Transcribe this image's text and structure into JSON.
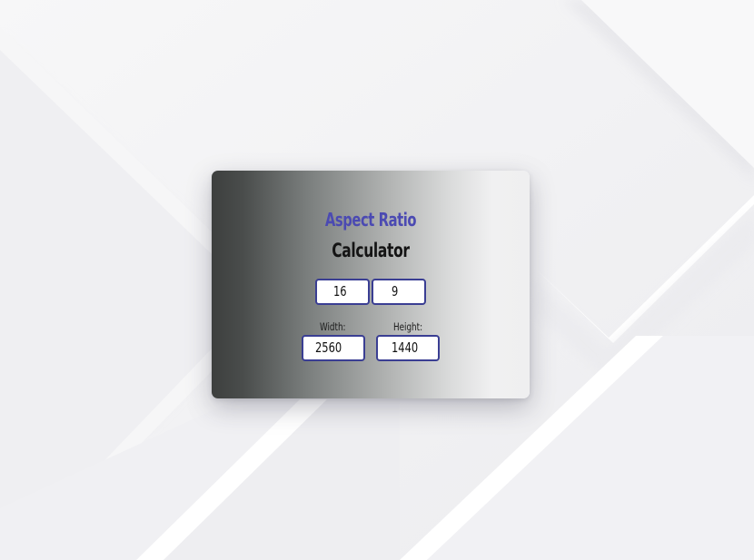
{
  "title": {
    "line1": "Aspect Ratio",
    "line2": "Calculator"
  },
  "ratio": {
    "a": "16",
    "b": "9"
  },
  "dimensions": {
    "width_label": "Width:",
    "height_label": "Height:",
    "width_value": "2560",
    "height_value": "1440"
  },
  "colors": {
    "title_accent": "#4b4ab2",
    "input_border": "#3a3e93",
    "page_background": "#f3f3f5"
  }
}
